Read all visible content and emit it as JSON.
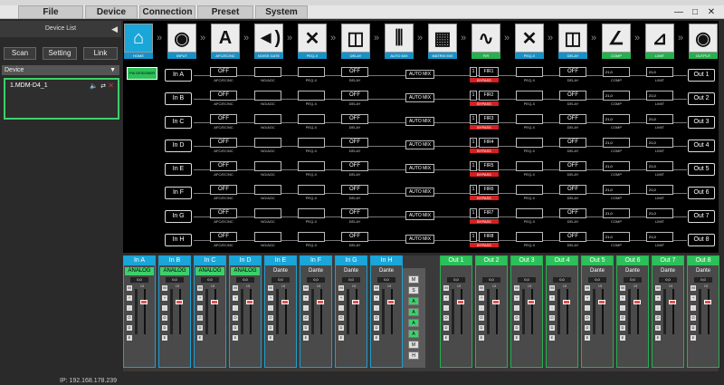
{
  "menu": {
    "file": "File",
    "device": "Device",
    "connection": "Connection",
    "preset": "Preset",
    "system": "System"
  },
  "window": {
    "minimize": "—",
    "restore": "□",
    "close": "✕"
  },
  "sidebar": {
    "device_list_label": "Device List",
    "scan": "Scan",
    "setting": "Setting",
    "link": "Link",
    "device_header": "Device",
    "device_item": "1.MDM-D4_1"
  },
  "status": {
    "ip": "IP: 192.168.178.239"
  },
  "modules": [
    {
      "label": "HOME",
      "glyph": "⌂"
    },
    {
      "label": "INPUT",
      "glyph": "◉"
    },
    {
      "label": "AFC/EC/NC",
      "glyph": "A"
    },
    {
      "label": "NOISE GATE",
      "glyph": "◄)"
    },
    {
      "label": "PEQ-X",
      "glyph": "✕"
    },
    {
      "label": "DELAY",
      "glyph": "◫"
    },
    {
      "label": "AUTO MIX",
      "glyph": "⫼"
    },
    {
      "label": "MATRIX MIX",
      "glyph": "▦"
    },
    {
      "label": "FIR",
      "glyph": "∿"
    },
    {
      "label": "PEQ-X",
      "glyph": "✕"
    },
    {
      "label": "DELAY",
      "glyph": "◫"
    },
    {
      "label": "COMP",
      "glyph": "∠"
    },
    {
      "label": "LIMIT",
      "glyph": "⊿"
    },
    {
      "label": "OUTPUT",
      "glyph": "◉"
    }
  ],
  "fw_button": "FW DESIGNER",
  "rows": [
    {
      "in": "In A",
      "afc": "OFF",
      "afc_sub": "AFC/EC/NC",
      "ng_sub": "NG/AGC",
      "peq_sub": "PEQ-X",
      "delay": "OFF",
      "delay_sub": "DELAY",
      "automix": "AUTO MIX",
      "fir_num": "1",
      "fir": "FIR1",
      "bypass": "BYPASS",
      "peq2_sub": "PEQ-X",
      "delay2": "OFF",
      "delay2_sub": "DELAY",
      "comp_val": "21,0",
      "comp_sub": "COMP",
      "limit_val": "21,0",
      "limit_sub": "LIMIT",
      "out": "Out 1"
    },
    {
      "in": "In B",
      "afc": "OFF",
      "afc_sub": "AFC/EC/NC",
      "ng_sub": "NG/AGC",
      "peq_sub": "PEQ-X",
      "delay": "OFF",
      "delay_sub": "DELAY",
      "automix": "AUTO MIX",
      "fir_num": "1",
      "fir": "FIR2",
      "bypass": "BYPASS",
      "peq2_sub": "PEQ-X",
      "delay2": "OFF",
      "delay2_sub": "DELAY",
      "comp_val": "21,0",
      "comp_sub": "COMP",
      "limit_val": "21,0",
      "limit_sub": "LIMIT",
      "out": "Out 2"
    },
    {
      "in": "In C",
      "afc": "OFF",
      "afc_sub": "AFC/EC/NC",
      "ng_sub": "NG/AGC",
      "peq_sub": "PEQ-X",
      "delay": "OFF",
      "delay_sub": "DELAY",
      "automix": "AUTO MIX",
      "fir_num": "1",
      "fir": "FIR3",
      "bypass": "BYPASS",
      "peq2_sub": "PEQ-X",
      "delay2": "OFF",
      "delay2_sub": "DELAY",
      "comp_val": "21,0",
      "comp_sub": "COMP",
      "limit_val": "21,0",
      "limit_sub": "LIMIT",
      "out": "Out 3"
    },
    {
      "in": "In D",
      "afc": "OFF",
      "afc_sub": "AFC/EC/NC",
      "ng_sub": "NG/AGC",
      "peq_sub": "PEQ-X",
      "delay": "OFF",
      "delay_sub": "DELAY",
      "automix": "AUTO MIX",
      "fir_num": "1",
      "fir": "FIR4",
      "bypass": "BYPASS",
      "peq2_sub": "PEQ-X",
      "delay2": "OFF",
      "delay2_sub": "DELAY",
      "comp_val": "21,0",
      "comp_sub": "COMP",
      "limit_val": "21,0",
      "limit_sub": "LIMIT",
      "out": "Out 4"
    },
    {
      "in": "In E",
      "afc": "OFF",
      "afc_sub": "AFC/EC/NC",
      "ng_sub": "NG/AGC",
      "peq_sub": "PEQ-X",
      "delay": "OFF",
      "delay_sub": "DELAY",
      "automix": "AUTO MIX",
      "fir_num": "1",
      "fir": "FIR5",
      "bypass": "BYPASS",
      "peq2_sub": "PEQ-X",
      "delay2": "OFF",
      "delay2_sub": "DELAY",
      "comp_val": "21,0",
      "comp_sub": "COMP",
      "limit_val": "21,0",
      "limit_sub": "LIMIT",
      "out": "Out 5"
    },
    {
      "in": "In F",
      "afc": "OFF",
      "afc_sub": "AFC/EC/NC",
      "ng_sub": "NG/AGC",
      "peq_sub": "PEQ-X",
      "delay": "OFF",
      "delay_sub": "DELAY",
      "automix": "AUTO MIX",
      "fir_num": "1",
      "fir": "FIR6",
      "bypass": "BYPASS",
      "peq2_sub": "PEQ-X",
      "delay2": "OFF",
      "delay2_sub": "DELAY",
      "comp_val": "21,0",
      "comp_sub": "COMP",
      "limit_val": "21,0",
      "limit_sub": "LIMIT",
      "out": "Out 6"
    },
    {
      "in": "In G",
      "afc": "OFF",
      "afc_sub": "AFC/EC/NC",
      "ng_sub": "NG/AGC",
      "peq_sub": "PEQ-X",
      "delay": "OFF",
      "delay_sub": "DELAY",
      "automix": "AUTO MIX",
      "fir_num": "1",
      "fir": "FIR7",
      "bypass": "BYPASS",
      "peq2_sub": "PEQ-X",
      "delay2": "OFF",
      "delay2_sub": "DELAY",
      "comp_val": "21,0",
      "comp_sub": "COMP",
      "limit_val": "21,0",
      "limit_sub": "LIMIT",
      "out": "Out 7"
    },
    {
      "in": "In H",
      "afc": "OFF",
      "afc_sub": "AFC/EC/NC",
      "ng_sub": "NG/AGC",
      "peq_sub": "PEQ-X",
      "delay": "OFF",
      "delay_sub": "DELAY",
      "automix": "AUTO MIX",
      "fir_num": "1",
      "fir": "FIR8",
      "bypass": "BYPASS",
      "peq2_sub": "PEQ-X",
      "delay2": "OFF",
      "delay2_sub": "DELAY",
      "comp_val": "21,0",
      "comp_sub": "COMP",
      "limit_val": "21,0",
      "limit_sub": "LIMIT",
      "out": "Out 8"
    }
  ],
  "mixer": {
    "inputs": [
      {
        "name": "In A",
        "type": "ANALOG",
        "gain": "0,0"
      },
      {
        "name": "In B",
        "type": "ANALOG",
        "gain": "0,0"
      },
      {
        "name": "In C",
        "type": "ANALOG",
        "gain": "0,0"
      },
      {
        "name": "In D",
        "type": "ANALOG",
        "gain": "0,0"
      },
      {
        "name": "In E",
        "type": "Dante",
        "gain": "0,0"
      },
      {
        "name": "In F",
        "type": "Dante",
        "gain": "0,0"
      },
      {
        "name": "In G",
        "type": "Dante",
        "gain": "0,0"
      },
      {
        "name": "In H",
        "type": "Dante",
        "gain": "0,0"
      }
    ],
    "outputs": [
      {
        "name": "Out 1",
        "type": "",
        "gain": "0,0"
      },
      {
        "name": "Out 2",
        "type": "",
        "gain": "0,0"
      },
      {
        "name": "Out 3",
        "type": "",
        "gain": "0,0"
      },
      {
        "name": "Out 4",
        "type": "",
        "gain": "0,0"
      },
      {
        "name": "Out 5",
        "type": "Dante",
        "gain": "0,0"
      },
      {
        "name": "Out 6",
        "type": "Dante",
        "gain": "0,0"
      },
      {
        "name": "Out 7",
        "type": "Dante",
        "gain": "0,0"
      },
      {
        "name": "Out 8",
        "type": "Dante",
        "gain": "0,0"
      }
    ],
    "strip_buttons": [
      "M",
      "+",
      "-",
      "∅",
      "D",
      "E"
    ],
    "center_buttons": [
      "M",
      "S",
      "A",
      "A",
      "A",
      "A",
      "M",
      "H"
    ],
    "fader_scale": "15"
  },
  "colors": {
    "accent_blue": "#1aa6d8",
    "accent_green": "#2dc05a",
    "bypass_red": "#d32020"
  }
}
